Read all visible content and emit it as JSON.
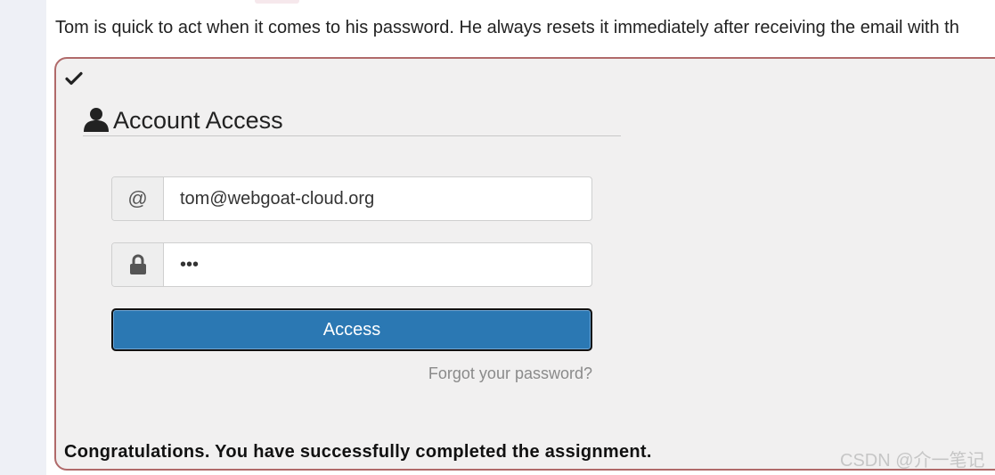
{
  "intro_text": "Tom is quick to act when it comes to his password. He always resets it immediately after receiving the email with th",
  "login_panel": {
    "status_icon": "checkmark-icon",
    "title": "Account Access",
    "title_icon": "user-icon",
    "email": {
      "addon": "@",
      "value": "tom@webgoat-cloud.org"
    },
    "password": {
      "addon_icon": "lock-icon",
      "value": "•••"
    },
    "access_button_label": "Access",
    "forgot_link": "Forgot your password?",
    "success_message": "Congratulations. You have successfully completed the assignment."
  },
  "watermark": "CSDN @介一笔记",
  "colors": {
    "panel_border": "#b06a6a",
    "panel_bg": "#f1f0f0",
    "button_bg": "#2b78b3",
    "left_strip": "#eef0f6"
  }
}
